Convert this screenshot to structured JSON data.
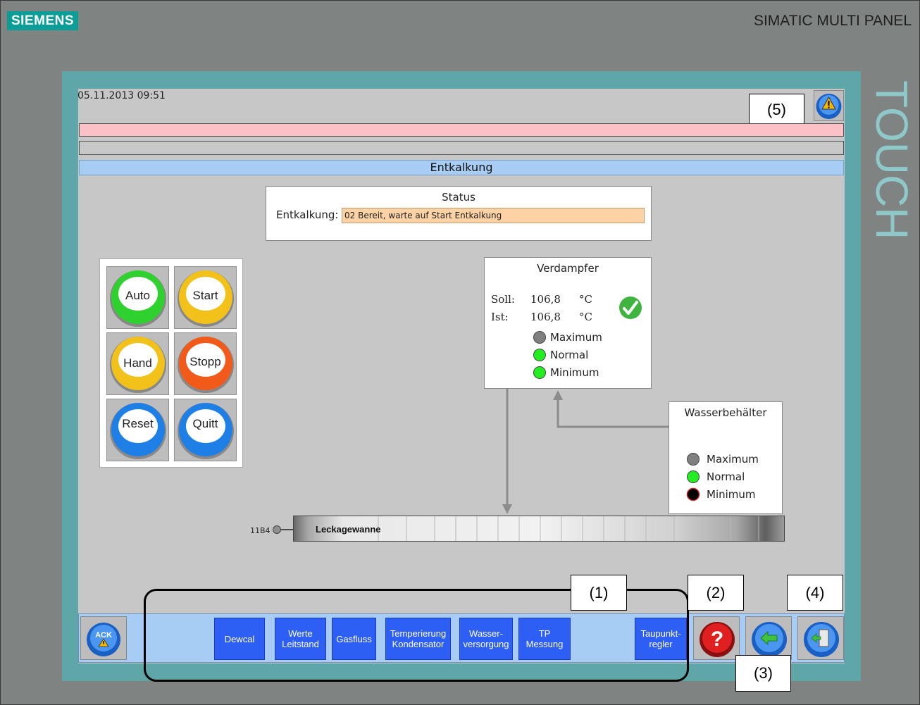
{
  "device": {
    "brand": "SIEMENS",
    "model": "SIMATIC MULTI PANEL",
    "side_label": "TOUCH"
  },
  "header": {
    "datetime": "05.11.2013 09:51",
    "title": "Entkalkung"
  },
  "status": {
    "title": "Status",
    "label": "Entkalkung:",
    "value": "02 Bereit, warte auf Start Entkalkung"
  },
  "control_buttons": [
    {
      "label": "Auto",
      "color": "#2fd12f"
    },
    {
      "label": "Start",
      "color": "#f2c21a"
    },
    {
      "label": "Hand",
      "color": "#f2c21a"
    },
    {
      "label": "Stopp",
      "color": "#f25a1a"
    },
    {
      "label": "Reset",
      "color": "#1e7fe6"
    },
    {
      "label": "Quitt",
      "color": "#1e7fe6"
    }
  ],
  "verdampfer": {
    "title": "Verdampfer",
    "soll_label": "Soll:",
    "soll_value": "106,8",
    "soll_unit": "°C",
    "ist_label": "Ist:",
    "ist_value": "106,8",
    "ist_unit": "°C",
    "status_icon": "checkmark-icon",
    "levels": [
      {
        "label": "Maximum",
        "color": "#808080"
      },
      {
        "label": "Normal",
        "color": "#22ee22"
      },
      {
        "label": "Minimum",
        "color": "#22ee22"
      }
    ]
  },
  "wasserbehaelter": {
    "title": "Wasserbehälter",
    "levels": [
      {
        "label": "Maximum",
        "color": "#808080"
      },
      {
        "label": "Normal",
        "color": "#22ee22"
      },
      {
        "label": "Minimum",
        "color": "#000000"
      }
    ]
  },
  "leckage": {
    "sensor": "11B4",
    "label": "Leckagewanne"
  },
  "nav": {
    "ack_label": "ACK",
    "buttons": [
      {
        "line1": "Dewcal",
        "line2": ""
      },
      {
        "line1": "Werte",
        "line2": "Leitstand"
      },
      {
        "line1": "Gasfluss",
        "line2": ""
      },
      {
        "line1": "Temperierung",
        "line2": "Kondensator"
      },
      {
        "line1": "Wasser-",
        "line2": "versorgung"
      },
      {
        "line1": "TP",
        "line2": "Messung"
      },
      {
        "line1": "Taupunkt-",
        "line2": "regler"
      }
    ]
  },
  "callouts": {
    "c1": "(1)",
    "c2": "(2)",
    "c3": "(3)",
    "c4": "(4)",
    "c5": "(5)"
  },
  "colors": {
    "accent_blue": "#2d5ff5",
    "title_bar": "#a7cdf5",
    "alarm_bar": "#fbc1c6",
    "bezel": "#5ea6a7"
  }
}
